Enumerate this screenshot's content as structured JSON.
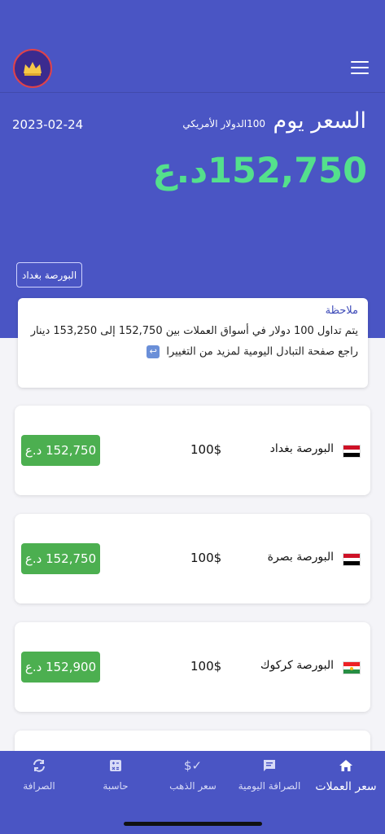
{
  "header": {
    "title": "السعر يوم",
    "subtitle": "100الدولار الأمريكي",
    "date": "2023-02-24",
    "big_price": "152,750د.ع",
    "exchange_button": "البورصة بغداد"
  },
  "note": {
    "title": "ملاحظة",
    "line1": "يتم تداول 100 دولار في أسواق العملات بين 152,750 إلى 153,250 دينار",
    "line2": "راجع صفحة التبادل اليومية لمزيد من التغييرا"
  },
  "rates": [
    {
      "name": "البورصة بغداد",
      "amount": "100$",
      "price": "152,750 د.ع",
      "flag": "iraq"
    },
    {
      "name": "البورصة بصرة",
      "amount": "100$",
      "price": "152,750 د.ع",
      "flag": "iraq"
    },
    {
      "name": "البورصة كركوك",
      "amount": "100$",
      "price": "152,900 د.ع",
      "flag": "kurdistan"
    }
  ],
  "nav": {
    "currency_rate": "سعر العملات",
    "daily_exchange": "الصرافة اليومية",
    "gold_price": "سعر الذهب",
    "calculator": "حاسبة",
    "exchange": "الصرافة"
  },
  "colors": {
    "primary": "#4a55c4",
    "accent_green": "#54e08c",
    "price_badge": "#4caf50"
  }
}
